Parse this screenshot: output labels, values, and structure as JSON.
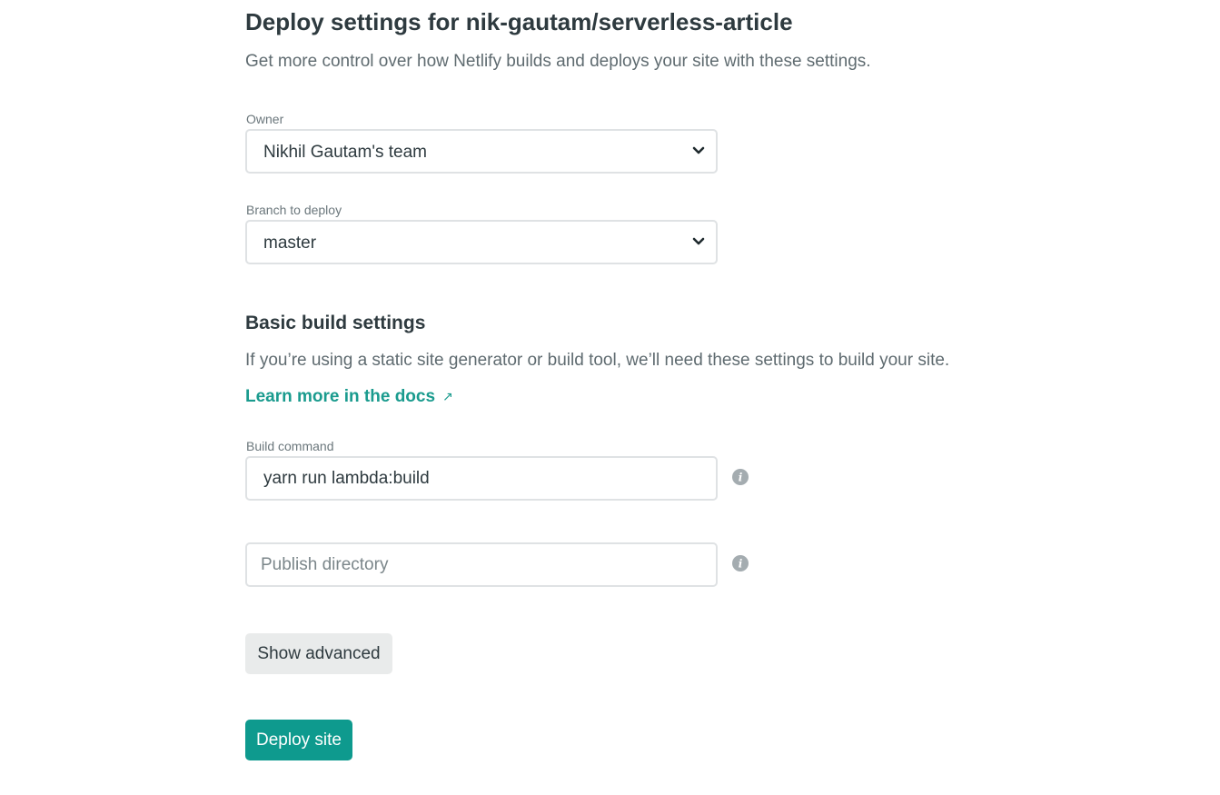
{
  "header": {
    "title": "Deploy settings for nik-gautam/serverless-article",
    "subtitle": "Get more control over how Netlify builds and deploys your site with these settings."
  },
  "owner": {
    "label": "Owner",
    "selected": "Nikhil Gautam's team",
    "icon": "chevron-down-icon"
  },
  "branch": {
    "label": "Branch to deploy",
    "selected": "master",
    "icon": "chevron-down-icon"
  },
  "build_settings": {
    "heading": "Basic build settings",
    "description": "If you’re using a static site generator or build tool, we’ll need these settings to build your site.",
    "docs_link": "Learn more in the docs",
    "docs_link_icon": "↗",
    "build_command": {
      "label": "Build command",
      "value": "yarn run lambda:build",
      "icon": "info-icon"
    },
    "publish_directory": {
      "placeholder": "Publish directory",
      "value": "",
      "icon": "info-icon"
    }
  },
  "actions": {
    "show_advanced": "Show advanced",
    "deploy": "Deploy site"
  },
  "colors": {
    "accent": "#0e9a8e",
    "link": "#1a9b8e",
    "text": "#2e3a3f",
    "muted": "#5f6b70",
    "border": "#dfe2e4",
    "secondary_button": "#e9ebeb"
  }
}
